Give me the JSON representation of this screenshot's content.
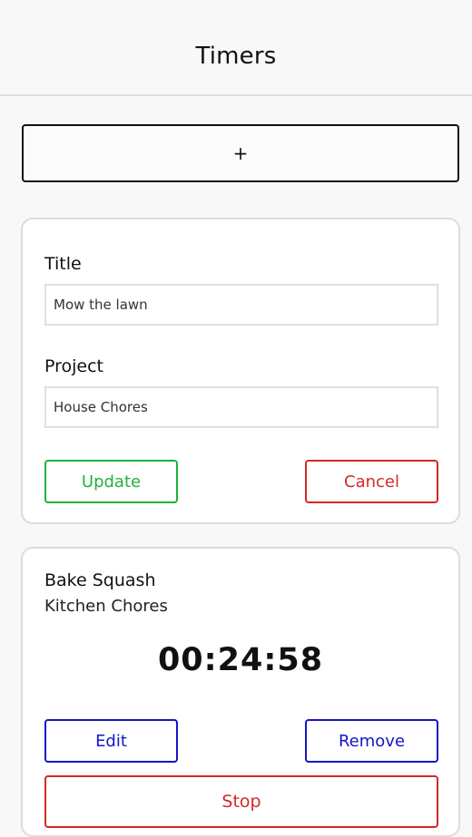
{
  "header": {
    "title": "Timers"
  },
  "add_button": {
    "label": "+"
  },
  "edit_form": {
    "title_label": "Title",
    "title_value": "Mow the lawn",
    "project_label": "Project",
    "project_value": "House Chores",
    "update_label": "Update",
    "cancel_label": "Cancel"
  },
  "timer": {
    "title": "Bake Squash",
    "project": "Kitchen Chores",
    "elapsed": "00:24:58",
    "edit_label": "Edit",
    "remove_label": "Remove",
    "stop_label": "Stop"
  },
  "colors": {
    "update": "#21b13c",
    "cancel": "#d32929",
    "edit_remove": "#1515c7",
    "stop": "#d32929"
  }
}
